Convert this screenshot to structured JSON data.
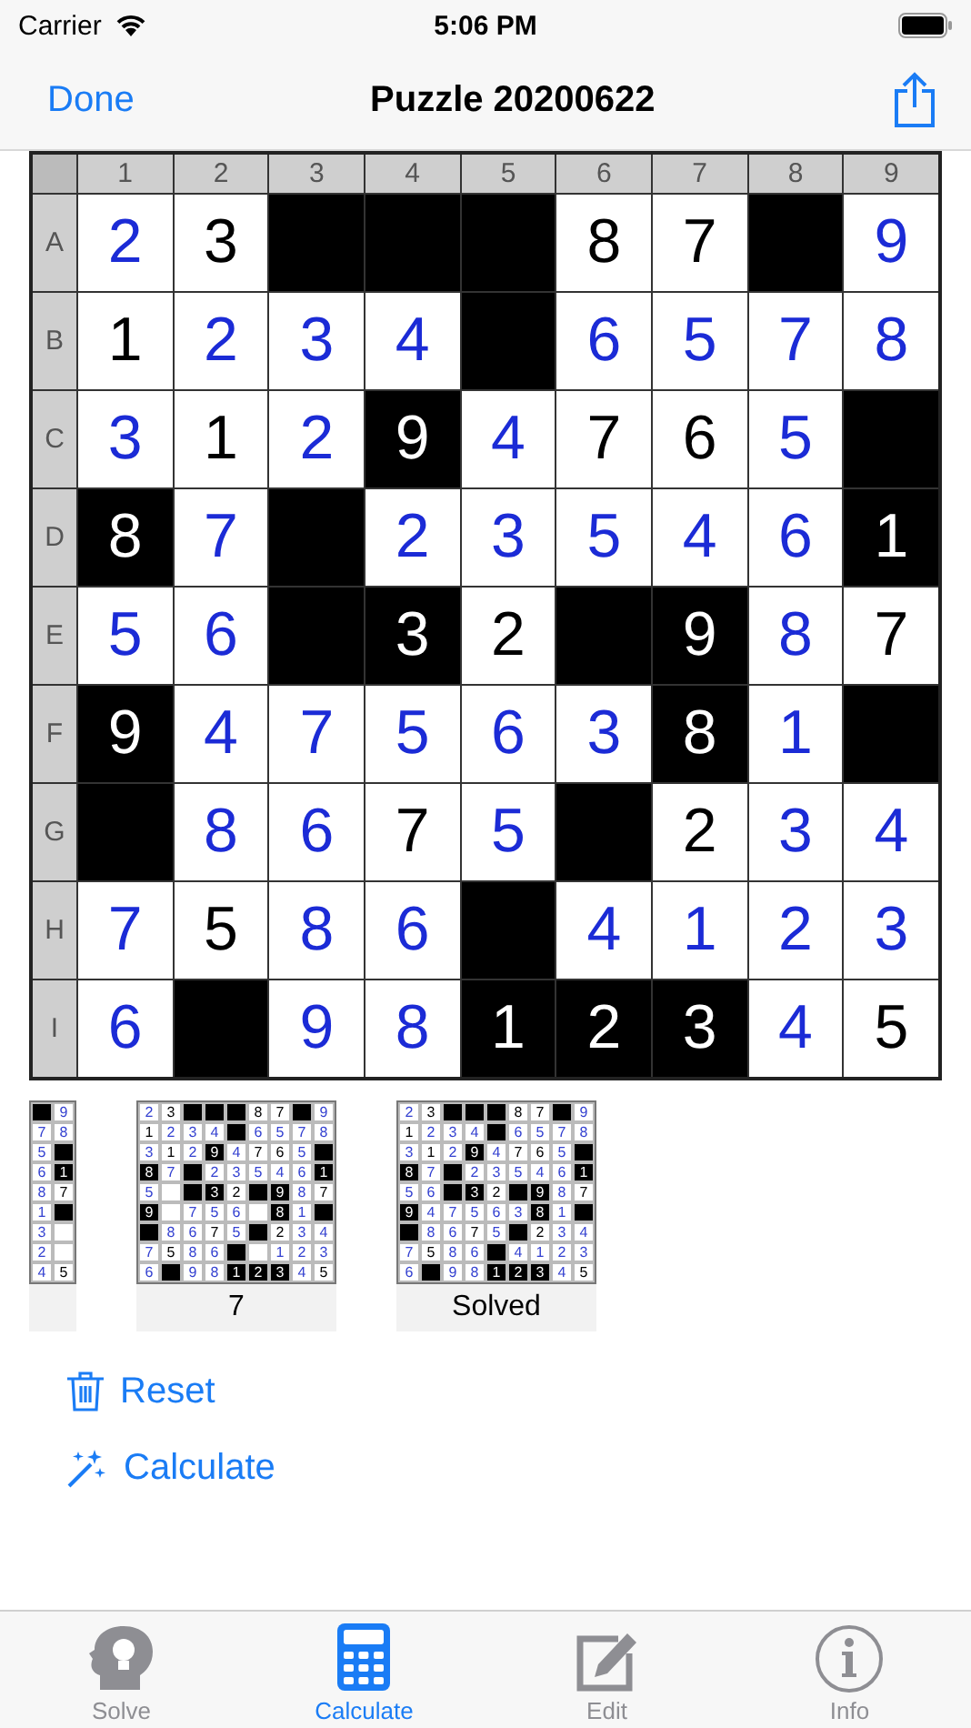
{
  "status_bar": {
    "carrier": "Carrier",
    "time": "5:06 PM"
  },
  "nav": {
    "back": "Done",
    "title": "Puzzle 20200622"
  },
  "grid": {
    "column_labels": [
      "1",
      "2",
      "3",
      "4",
      "5",
      "6",
      "7",
      "8",
      "9"
    ],
    "rows": [
      {
        "label": "A",
        "cells": [
          {
            "kind": "entered",
            "digit": "2"
          },
          {
            "kind": "given",
            "digit": "3"
          },
          {
            "kind": "block"
          },
          {
            "kind": "block"
          },
          {
            "kind": "block"
          },
          {
            "kind": "given",
            "digit": "8"
          },
          {
            "kind": "given",
            "digit": "7"
          },
          {
            "kind": "block"
          },
          {
            "kind": "entered",
            "digit": "9"
          }
        ]
      },
      {
        "label": "B",
        "cells": [
          {
            "kind": "given",
            "digit": "1"
          },
          {
            "kind": "entered",
            "digit": "2"
          },
          {
            "kind": "entered",
            "digit": "3"
          },
          {
            "kind": "entered",
            "digit": "4"
          },
          {
            "kind": "block"
          },
          {
            "kind": "entered",
            "digit": "6"
          },
          {
            "kind": "entered",
            "digit": "5"
          },
          {
            "kind": "entered",
            "digit": "7"
          },
          {
            "kind": "entered",
            "digit": "8"
          }
        ]
      },
      {
        "label": "C",
        "cells": [
          {
            "kind": "entered",
            "digit": "3"
          },
          {
            "kind": "given",
            "digit": "1"
          },
          {
            "kind": "entered",
            "digit": "2"
          },
          {
            "kind": "clue",
            "digit": "9"
          },
          {
            "kind": "entered",
            "digit": "4"
          },
          {
            "kind": "given",
            "digit": "7"
          },
          {
            "kind": "given",
            "digit": "6"
          },
          {
            "kind": "entered",
            "digit": "5"
          },
          {
            "kind": "block"
          }
        ]
      },
      {
        "label": "D",
        "cells": [
          {
            "kind": "clue",
            "digit": "8"
          },
          {
            "kind": "entered",
            "digit": "7"
          },
          {
            "kind": "block"
          },
          {
            "kind": "entered",
            "digit": "2"
          },
          {
            "kind": "entered",
            "digit": "3"
          },
          {
            "kind": "entered",
            "digit": "5"
          },
          {
            "kind": "entered",
            "digit": "4"
          },
          {
            "kind": "entered",
            "digit": "6"
          },
          {
            "kind": "clue",
            "digit": "1"
          }
        ]
      },
      {
        "label": "E",
        "cells": [
          {
            "kind": "entered",
            "digit": "5"
          },
          {
            "kind": "entered",
            "digit": "6"
          },
          {
            "kind": "block"
          },
          {
            "kind": "clue",
            "digit": "3"
          },
          {
            "kind": "given",
            "digit": "2"
          },
          {
            "kind": "block"
          },
          {
            "kind": "clue",
            "digit": "9"
          },
          {
            "kind": "entered",
            "digit": "8"
          },
          {
            "kind": "given",
            "digit": "7"
          }
        ]
      },
      {
        "label": "F",
        "cells": [
          {
            "kind": "clue",
            "digit": "9"
          },
          {
            "kind": "entered",
            "digit": "4"
          },
          {
            "kind": "entered",
            "digit": "7"
          },
          {
            "kind": "entered",
            "digit": "5"
          },
          {
            "kind": "entered",
            "digit": "6"
          },
          {
            "kind": "entered",
            "digit": "3"
          },
          {
            "kind": "clue",
            "digit": "8"
          },
          {
            "kind": "entered",
            "digit": "1"
          },
          {
            "kind": "block"
          }
        ]
      },
      {
        "label": "G",
        "cells": [
          {
            "kind": "block"
          },
          {
            "kind": "entered",
            "digit": "8"
          },
          {
            "kind": "entered",
            "digit": "6"
          },
          {
            "kind": "given",
            "digit": "7"
          },
          {
            "kind": "entered",
            "digit": "5"
          },
          {
            "kind": "block"
          },
          {
            "kind": "given",
            "digit": "2"
          },
          {
            "kind": "entered",
            "digit": "3"
          },
          {
            "kind": "entered",
            "digit": "4"
          }
        ]
      },
      {
        "label": "H",
        "cells": [
          {
            "kind": "entered",
            "digit": "7"
          },
          {
            "kind": "given",
            "digit": "5"
          },
          {
            "kind": "entered",
            "digit": "8"
          },
          {
            "kind": "entered",
            "digit": "6"
          },
          {
            "kind": "block"
          },
          {
            "kind": "entered",
            "digit": "4"
          },
          {
            "kind": "entered",
            "digit": "1"
          },
          {
            "kind": "entered",
            "digit": "2"
          },
          {
            "kind": "entered",
            "digit": "3"
          }
        ]
      },
      {
        "label": "I",
        "cells": [
          {
            "kind": "entered",
            "digit": "6"
          },
          {
            "kind": "block"
          },
          {
            "kind": "entered",
            "digit": "9"
          },
          {
            "kind": "entered",
            "digit": "8"
          },
          {
            "kind": "clue",
            "digit": "1"
          },
          {
            "kind": "clue",
            "digit": "2"
          },
          {
            "kind": "clue",
            "digit": "3"
          },
          {
            "kind": "entered",
            "digit": "4"
          },
          {
            "kind": "given",
            "digit": "5"
          }
        ]
      }
    ]
  },
  "thumbnails": [
    {
      "rows": [
        [
          {
            "kind": "block"
          },
          {
            "kind": "entered",
            "digit": "9"
          }
        ],
        [
          {
            "kind": "entered",
            "digit": "7"
          },
          {
            "kind": "entered",
            "digit": "8"
          }
        ],
        [
          {
            "kind": "entered",
            "digit": "5"
          },
          {
            "kind": "block"
          }
        ],
        [
          {
            "kind": "entered",
            "digit": "6"
          },
          {
            "kind": "clue",
            "digit": "1"
          }
        ],
        [
          {
            "kind": "entered",
            "digit": "8"
          },
          {
            "kind": "given",
            "digit": "7"
          }
        ],
        [
          {
            "kind": "entered",
            "digit": "1"
          },
          {
            "kind": "block"
          }
        ],
        [
          {
            "kind": "entered",
            "digit": "3"
          },
          {
            "kind": "empty"
          }
        ],
        [
          {
            "kind": "entered",
            "digit": "2"
          },
          {
            "kind": "empty"
          }
        ],
        [
          {
            "kind": "entered",
            "digit": "4"
          },
          {
            "kind": "given",
            "digit": "5"
          }
        ]
      ]
    },
    {
      "label": "7",
      "rows": [
        [
          {
            "kind": "entered",
            "digit": "2"
          },
          {
            "kind": "given",
            "digit": "3"
          },
          {
            "kind": "block"
          },
          {
            "kind": "block"
          },
          {
            "kind": "block"
          },
          {
            "kind": "given",
            "digit": "8"
          },
          {
            "kind": "given",
            "digit": "7"
          },
          {
            "kind": "block"
          },
          {
            "kind": "entered",
            "digit": "9"
          }
        ],
        [
          {
            "kind": "given",
            "digit": "1"
          },
          {
            "kind": "entered",
            "digit": "2"
          },
          {
            "kind": "entered",
            "digit": "3"
          },
          {
            "kind": "entered",
            "digit": "4"
          },
          {
            "kind": "block"
          },
          {
            "kind": "entered",
            "digit": "6"
          },
          {
            "kind": "entered",
            "digit": "5"
          },
          {
            "kind": "entered",
            "digit": "7"
          },
          {
            "kind": "entered",
            "digit": "8"
          }
        ],
        [
          {
            "kind": "entered",
            "digit": "3"
          },
          {
            "kind": "given",
            "digit": "1"
          },
          {
            "kind": "entered",
            "digit": "2"
          },
          {
            "kind": "clue",
            "digit": "9"
          },
          {
            "kind": "entered",
            "digit": "4"
          },
          {
            "kind": "given",
            "digit": "7"
          },
          {
            "kind": "given",
            "digit": "6"
          },
          {
            "kind": "entered",
            "digit": "5"
          },
          {
            "kind": "block"
          }
        ],
        [
          {
            "kind": "clue",
            "digit": "8"
          },
          {
            "kind": "entered",
            "digit": "7"
          },
          {
            "kind": "block"
          },
          {
            "kind": "entered",
            "digit": "2"
          },
          {
            "kind": "entered",
            "digit": "3"
          },
          {
            "kind": "entered",
            "digit": "5"
          },
          {
            "kind": "entered",
            "digit": "4"
          },
          {
            "kind": "entered",
            "digit": "6"
          },
          {
            "kind": "clue",
            "digit": "1"
          }
        ],
        [
          {
            "kind": "entered",
            "digit": "5"
          },
          {
            "kind": "empty"
          },
          {
            "kind": "block"
          },
          {
            "kind": "clue",
            "digit": "3"
          },
          {
            "kind": "given",
            "digit": "2"
          },
          {
            "kind": "block"
          },
          {
            "kind": "clue",
            "digit": "9"
          },
          {
            "kind": "entered",
            "digit": "8"
          },
          {
            "kind": "given",
            "digit": "7"
          }
        ],
        [
          {
            "kind": "clue",
            "digit": "9"
          },
          {
            "kind": "empty"
          },
          {
            "kind": "entered",
            "digit": "7"
          },
          {
            "kind": "entered",
            "digit": "5"
          },
          {
            "kind": "entered",
            "digit": "6"
          },
          {
            "kind": "empty"
          },
          {
            "kind": "clue",
            "digit": "8"
          },
          {
            "kind": "entered",
            "digit": "1"
          },
          {
            "kind": "block"
          }
        ],
        [
          {
            "kind": "block"
          },
          {
            "kind": "entered",
            "digit": "8"
          },
          {
            "kind": "entered",
            "digit": "6"
          },
          {
            "kind": "given",
            "digit": "7"
          },
          {
            "kind": "entered",
            "digit": "5"
          },
          {
            "kind": "block"
          },
          {
            "kind": "given",
            "digit": "2"
          },
          {
            "kind": "entered",
            "digit": "3"
          },
          {
            "kind": "entered",
            "digit": "4"
          }
        ],
        [
          {
            "kind": "entered",
            "digit": "7"
          },
          {
            "kind": "given",
            "digit": "5"
          },
          {
            "kind": "entered",
            "digit": "8"
          },
          {
            "kind": "entered",
            "digit": "6"
          },
          {
            "kind": "block"
          },
          {
            "kind": "empty"
          },
          {
            "kind": "entered",
            "digit": "1"
          },
          {
            "kind": "entered",
            "digit": "2"
          },
          {
            "kind": "entered",
            "digit": "3"
          }
        ],
        [
          {
            "kind": "entered",
            "digit": "6"
          },
          {
            "kind": "block"
          },
          {
            "kind": "entered",
            "digit": "9"
          },
          {
            "kind": "entered",
            "digit": "8"
          },
          {
            "kind": "clue",
            "digit": "1"
          },
          {
            "kind": "clue",
            "digit": "2"
          },
          {
            "kind": "clue",
            "digit": "3"
          },
          {
            "kind": "entered",
            "digit": "4"
          },
          {
            "kind": "given",
            "digit": "5"
          }
        ]
      ]
    },
    {
      "label": "Solved",
      "rows": [
        [
          {
            "kind": "entered",
            "digit": "2"
          },
          {
            "kind": "given",
            "digit": "3"
          },
          {
            "kind": "block"
          },
          {
            "kind": "block"
          },
          {
            "kind": "block"
          },
          {
            "kind": "given",
            "digit": "8"
          },
          {
            "kind": "given",
            "digit": "7"
          },
          {
            "kind": "block"
          },
          {
            "kind": "entered",
            "digit": "9"
          }
        ],
        [
          {
            "kind": "given",
            "digit": "1"
          },
          {
            "kind": "entered",
            "digit": "2"
          },
          {
            "kind": "entered",
            "digit": "3"
          },
          {
            "kind": "entered",
            "digit": "4"
          },
          {
            "kind": "block"
          },
          {
            "kind": "entered",
            "digit": "6"
          },
          {
            "kind": "entered",
            "digit": "5"
          },
          {
            "kind": "entered",
            "digit": "7"
          },
          {
            "kind": "entered",
            "digit": "8"
          }
        ],
        [
          {
            "kind": "entered",
            "digit": "3"
          },
          {
            "kind": "given",
            "digit": "1"
          },
          {
            "kind": "entered",
            "digit": "2"
          },
          {
            "kind": "clue",
            "digit": "9"
          },
          {
            "kind": "entered",
            "digit": "4"
          },
          {
            "kind": "given",
            "digit": "7"
          },
          {
            "kind": "given",
            "digit": "6"
          },
          {
            "kind": "entered",
            "digit": "5"
          },
          {
            "kind": "block"
          }
        ],
        [
          {
            "kind": "clue",
            "digit": "8"
          },
          {
            "kind": "entered",
            "digit": "7"
          },
          {
            "kind": "block"
          },
          {
            "kind": "entered",
            "digit": "2"
          },
          {
            "kind": "entered",
            "digit": "3"
          },
          {
            "kind": "entered",
            "digit": "5"
          },
          {
            "kind": "entered",
            "digit": "4"
          },
          {
            "kind": "entered",
            "digit": "6"
          },
          {
            "kind": "clue",
            "digit": "1"
          }
        ],
        [
          {
            "kind": "entered",
            "digit": "5"
          },
          {
            "kind": "entered",
            "digit": "6"
          },
          {
            "kind": "block"
          },
          {
            "kind": "clue",
            "digit": "3"
          },
          {
            "kind": "given",
            "digit": "2"
          },
          {
            "kind": "block"
          },
          {
            "kind": "clue",
            "digit": "9"
          },
          {
            "kind": "entered",
            "digit": "8"
          },
          {
            "kind": "given",
            "digit": "7"
          }
        ],
        [
          {
            "kind": "clue",
            "digit": "9"
          },
          {
            "kind": "entered",
            "digit": "4"
          },
          {
            "kind": "entered",
            "digit": "7"
          },
          {
            "kind": "entered",
            "digit": "5"
          },
          {
            "kind": "entered",
            "digit": "6"
          },
          {
            "kind": "entered",
            "digit": "3"
          },
          {
            "kind": "clue",
            "digit": "8"
          },
          {
            "kind": "entered",
            "digit": "1"
          },
          {
            "kind": "block"
          }
        ],
        [
          {
            "kind": "block"
          },
          {
            "kind": "entered",
            "digit": "8"
          },
          {
            "kind": "entered",
            "digit": "6"
          },
          {
            "kind": "given",
            "digit": "7"
          },
          {
            "kind": "entered",
            "digit": "5"
          },
          {
            "kind": "block"
          },
          {
            "kind": "given",
            "digit": "2"
          },
          {
            "kind": "entered",
            "digit": "3"
          },
          {
            "kind": "entered",
            "digit": "4"
          }
        ],
        [
          {
            "kind": "entered",
            "digit": "7"
          },
          {
            "kind": "given",
            "digit": "5"
          },
          {
            "kind": "entered",
            "digit": "8"
          },
          {
            "kind": "entered",
            "digit": "6"
          },
          {
            "kind": "block"
          },
          {
            "kind": "entered",
            "digit": "4"
          },
          {
            "kind": "entered",
            "digit": "1"
          },
          {
            "kind": "entered",
            "digit": "2"
          },
          {
            "kind": "entered",
            "digit": "3"
          }
        ],
        [
          {
            "kind": "entered",
            "digit": "6"
          },
          {
            "kind": "block"
          },
          {
            "kind": "entered",
            "digit": "9"
          },
          {
            "kind": "entered",
            "digit": "8"
          },
          {
            "kind": "clue",
            "digit": "1"
          },
          {
            "kind": "clue",
            "digit": "2"
          },
          {
            "kind": "clue",
            "digit": "3"
          },
          {
            "kind": "entered",
            "digit": "4"
          },
          {
            "kind": "given",
            "digit": "5"
          }
        ]
      ]
    }
  ],
  "actions": [
    {
      "kind": "reset",
      "label": "Reset"
    },
    {
      "kind": "calculate",
      "label": "Calculate"
    }
  ],
  "tabs": [
    {
      "kind": "solve",
      "label": "Solve",
      "selected": false
    },
    {
      "kind": "calculate",
      "label": "Calculate",
      "selected": true
    },
    {
      "kind": "edit",
      "label": "Edit",
      "selected": false
    },
    {
      "kind": "info",
      "label": "Info",
      "selected": false
    }
  ]
}
